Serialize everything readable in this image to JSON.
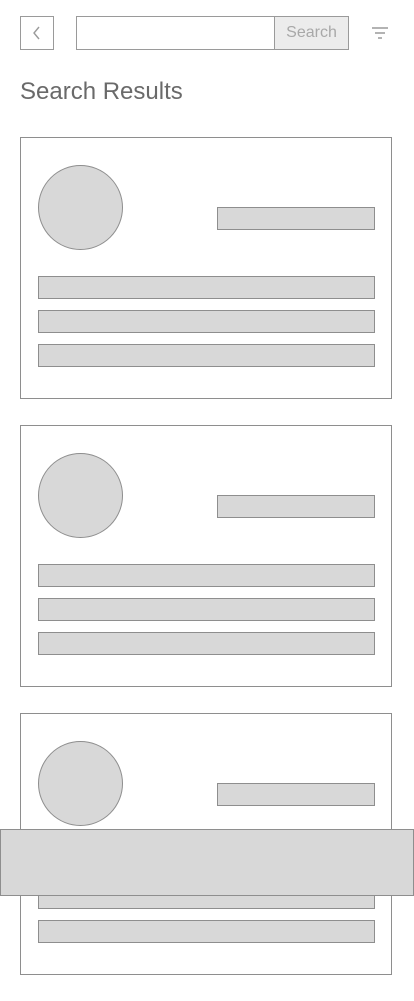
{
  "header": {
    "back_icon": "chevron-left-icon",
    "search": {
      "value": "",
      "placeholder": "",
      "button_label": "Search"
    },
    "filter_icon": "filter-icon"
  },
  "page": {
    "title": "Search Results"
  },
  "results": {
    "count_visible": 3
  },
  "colors": {
    "placeholder_fill": "#d8d8d8",
    "border": "#8e8e8e",
    "text": "#6a6a6a"
  }
}
